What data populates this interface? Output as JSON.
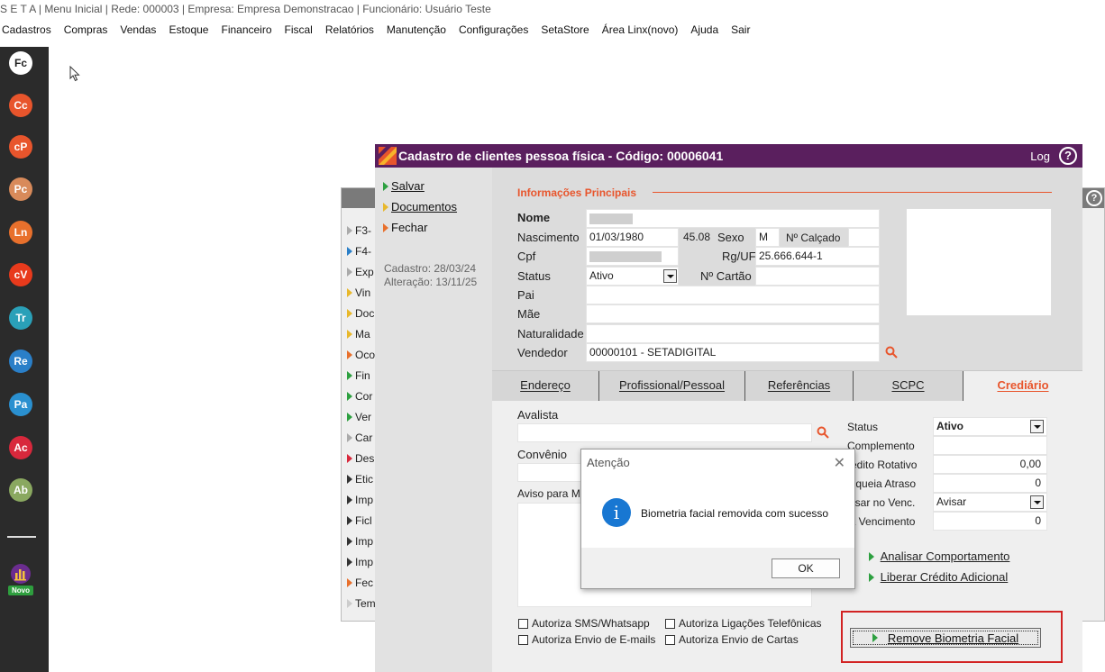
{
  "app": {
    "title": "S E T A | Menu Inicial | Rede: 000003 | Empresa: Empresa Demonstracao | Funcionário: Usuário Teste"
  },
  "menu": [
    "Cadastros",
    "Compras",
    "Vendas",
    "Estoque",
    "Financeiro",
    "Fiscal",
    "Relatórios",
    "Manutenção",
    "Configurações",
    "SetaStore",
    "Área Linx(novo)",
    "Ajuda",
    "Sair"
  ],
  "sidebar": {
    "items": [
      {
        "label": "Fc",
        "color": "#ffffff",
        "text_color": "#222222"
      },
      {
        "label": "Cc",
        "color": "#e8552c"
      },
      {
        "label": "cP",
        "color": "#e8552c"
      },
      {
        "label": "Pc",
        "color": "#d88a5a"
      },
      {
        "label": "Ln",
        "color": "#e8702c"
      },
      {
        "label": "cV",
        "color": "#e83a1c"
      },
      {
        "label": "Tr",
        "color": "#2aa0b8"
      },
      {
        "label": "Re",
        "color": "#2a7fc8"
      },
      {
        "label": "Pa",
        "color": "#2a90d0"
      },
      {
        "label": "Ac",
        "color": "#d8283c"
      },
      {
        "label": "Ab",
        "color": "#8aa860"
      }
    ],
    "novo_badge": "Novo"
  },
  "background_window": {
    "items": [
      "F3-",
      "F4-",
      "Exp",
      "Vin",
      "Doc",
      "Ma",
      "Oco",
      "Fin",
      "Cor",
      "Ver",
      "Car",
      "Des",
      "Etic",
      "Imp",
      "Ficl",
      "Imp",
      "Imp",
      "Fec",
      "Temp"
    ],
    "item_colors": [
      "#aaaaaa",
      "#2a7fc8",
      "#aaaaaa",
      "#e8b82c",
      "#e8b82c",
      "#e8b82c",
      "#e8702c",
      "#2da040",
      "#2da040",
      "#2da040",
      "#aaaaaa",
      "#d8283c",
      "#333333",
      "#333333",
      "#333333",
      "#333333",
      "#333333",
      "#e8702c",
      "#cccccc"
    ]
  },
  "dialog": {
    "title": "Cadastro de clientes pessoa física - Código: 00006041",
    "log_label": "Log",
    "help_label": "?",
    "actions": [
      {
        "label": "Salvar",
        "color": "#2da040"
      },
      {
        "label": "Documentos",
        "color": "#e8b82c"
      },
      {
        "label": "Fechar",
        "color": "#e8702c"
      }
    ],
    "cadastro": "Cadastro: 28/03/24",
    "alteracao": "Alteração: 13/11/25",
    "section_title": "Informações Principais",
    "fields": {
      "nome_label": "Nome",
      "nascimento_label": "Nascimento",
      "nascimento_value": "01/03/1980",
      "idade_value": "45.08",
      "sexo_label": "Sexo",
      "sexo_value": "M",
      "calcado_label": "Nº Calçado",
      "cpf_label": "Cpf",
      "rg_label": "Rg/UF",
      "rg_value": "25.666.644-1",
      "status_label": "Status",
      "status_value": "Ativo",
      "cartao_label": "Nº Cartão",
      "pai_label": "Pai",
      "mae_label": "Mãe",
      "naturalidade_label": "Naturalidade",
      "vendedor_label": "Vendedor",
      "vendedor_value": "00000101 - SETADIGITAL"
    },
    "tabs": [
      "Endereço",
      "Profissional/Pessoal",
      "Referências",
      "SCPC",
      "Crediário"
    ],
    "active_tab": "Crediário",
    "crediario": {
      "avalista_label": "Avalista",
      "convenio_label": "Convênio",
      "aviso_label": "Aviso para M",
      "status_label": "Status",
      "status_value": "Ativo",
      "complemento_label": "Complemento",
      "credito_label": "rédito Rotativo",
      "credito_value": "0,00",
      "bloqueia_label": "loqueia Atraso",
      "bloqueia_value": "0",
      "avisar_label": "visar no Venc.",
      "avisar_value": "Avisar",
      "dias_label": "ia Vencimento",
      "dias_value": "0",
      "analisar_label": "Analisar Comportamento",
      "liberar_label": "Liberar Crédito Adicional",
      "checks": [
        "Autoriza SMS/Whatsapp",
        "Autoriza Ligações Telefônicas",
        "Autoriza Envio de E-mails",
        "Autoriza Envio de Cartas"
      ],
      "remove_label": "Remove Biometria Facial"
    }
  },
  "modal": {
    "title": "Atenção",
    "message": "Biometria facial removida com sucesso",
    "ok_label": "OK",
    "info_glyph": "i",
    "close_glyph": "✕"
  }
}
